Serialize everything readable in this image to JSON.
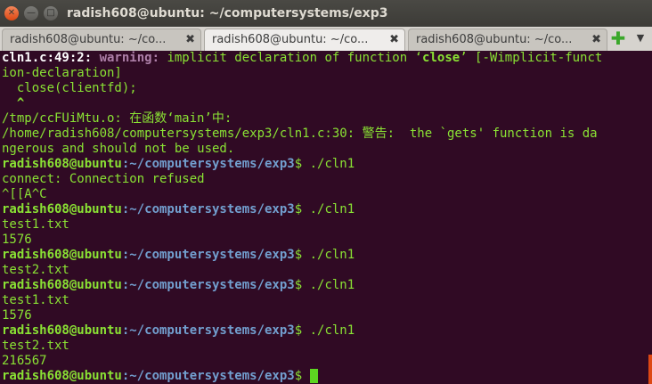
{
  "window": {
    "title": "radish608@ubuntu: ~/computersystems/exp3",
    "close_glyph": "✕",
    "min_glyph": "—",
    "max_glyph": "□"
  },
  "tabs": [
    {
      "label": "radish608@ubuntu: ~/co...",
      "close": "✖"
    },
    {
      "label": "radish608@ubuntu: ~/co...",
      "close": "✖"
    },
    {
      "label": "radish608@ubuntu: ~/co...",
      "close": "✖"
    }
  ],
  "tabbar": {
    "new_tab": "✚",
    "menu": "▼"
  },
  "terminal": {
    "l1": {
      "file": "cln1.c:49:2: ",
      "warn": "warning: ",
      "msg": "implicit declaration of function ",
      "q1": "‘",
      "fn": "close",
      "q2": "’",
      "flag": " [-Wimplicit-funct"
    },
    "l2": "ion-declaration]",
    "l3": "  close(clientfd);",
    "l4": "  ^",
    "l5": "/tmp/ccFUiMtu.o: 在函数‘main’中:",
    "l6": "/home/radish608/computersystems/exp3/cln1.c:30: 警告:  the `gets' function is da",
    "l7": "ngerous and should not be used.",
    "prompt": {
      "user": "radish608@ubuntu",
      "path": ":~/computersystems/exp3",
      "dollar": "$ "
    },
    "cmd": "./cln1",
    "out_connect": "connect: Connection refused",
    "out_esc": "^[[A^C",
    "out_test1": "test1.txt",
    "out_1576": "1576",
    "out_test2": "test2.txt",
    "out_216567": "216567"
  }
}
